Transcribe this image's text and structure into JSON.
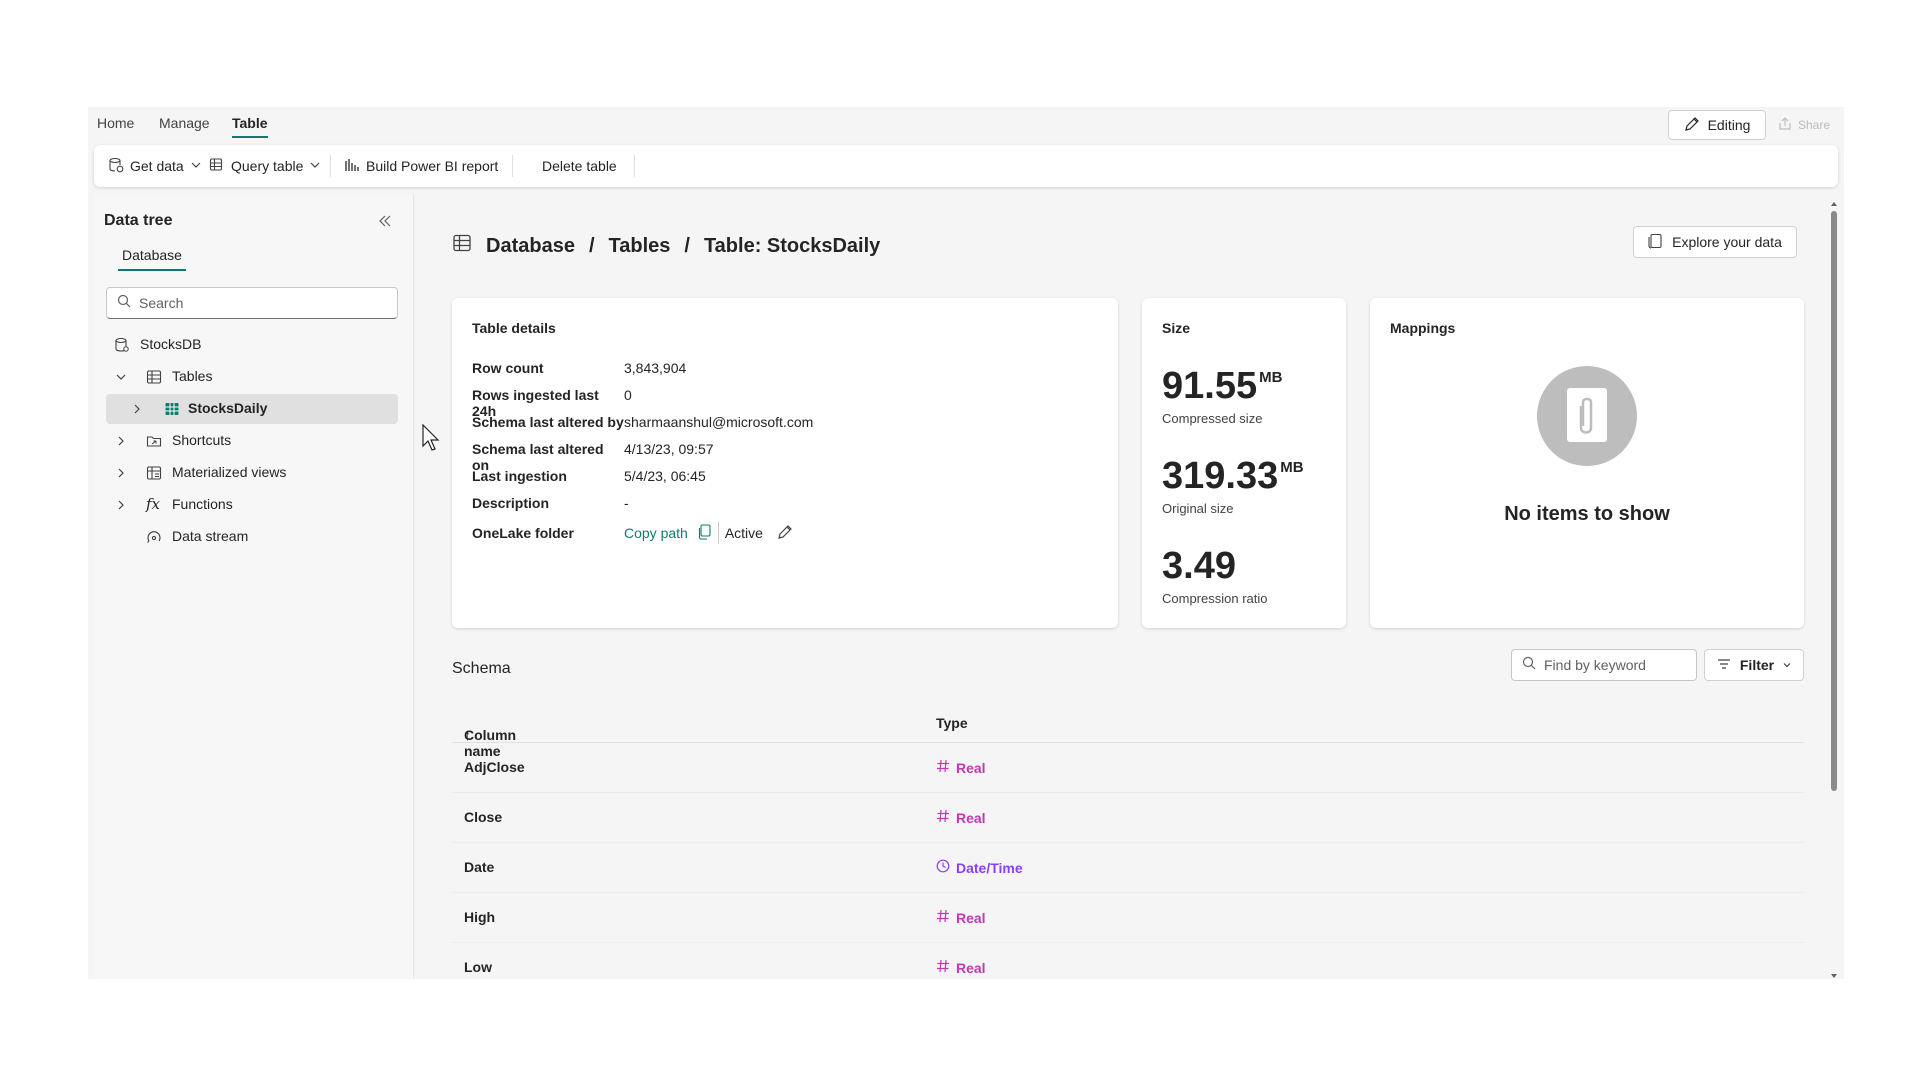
{
  "topnav": {
    "tabs": [
      {
        "label": "Home"
      },
      {
        "label": "Manage"
      },
      {
        "label": "Table"
      }
    ],
    "active_tab": "Table",
    "editing_label": "Editing",
    "share_label": "Share"
  },
  "ribbon": {
    "get_data": "Get data",
    "query_table": "Query table",
    "build_report": "Build Power BI report",
    "delete_table": "Delete table"
  },
  "sidebar": {
    "title": "Data tree",
    "tab": "Database",
    "search_placeholder": "Search",
    "items": [
      {
        "label": "StocksDB",
        "icon": "database-icon"
      },
      {
        "label": "Tables",
        "icon": "table-icon",
        "expanded": true
      },
      {
        "label": "StocksDaily",
        "icon": "table-icon",
        "selected": true
      },
      {
        "label": "Shortcuts",
        "icon": "shortcut-icon"
      },
      {
        "label": "Materialized views",
        "icon": "materialized-view-icon"
      },
      {
        "label": "Functions",
        "icon": "function-icon"
      },
      {
        "label": "Data stream",
        "icon": "data-stream-icon"
      }
    ]
  },
  "breadcrumb": {
    "items": [
      "Database",
      "Tables",
      "Table: StocksDaily"
    ],
    "separator": "/"
  },
  "explore_label": "Explore your data",
  "table_details": {
    "title": "Table details",
    "rows": [
      {
        "key": "Row count",
        "value": "3,843,904"
      },
      {
        "key": "Rows ingested last 24h",
        "value": "0"
      },
      {
        "key": "Schema last altered by",
        "value": "sharmaanshul@microsoft.com"
      },
      {
        "key": "Schema last altered on",
        "value": "4/13/23, 09:57"
      },
      {
        "key": "Last ingestion",
        "value": "5/4/23, 06:45"
      },
      {
        "key": "Description",
        "value": "-"
      }
    ],
    "onelake_key": "OneLake folder",
    "copy_path": "Copy path",
    "status": "Active"
  },
  "size": {
    "title": "Size",
    "compressed_value": "91.55",
    "compressed_unit": "MB",
    "compressed_label": "Compressed size",
    "original_value": "319.33",
    "original_unit": "MB",
    "original_label": "Original size",
    "ratio_value": "3.49",
    "ratio_label": "Compression ratio"
  },
  "mappings": {
    "title": "Mappings",
    "empty_text": "No items to show"
  },
  "schema": {
    "title": "Schema",
    "find_placeholder": "Find by keyword",
    "filter_label": "Filter",
    "columns": [
      "Column name",
      "Type"
    ],
    "sort_indicator": "↑",
    "rows": [
      {
        "name": "AdjClose",
        "type": "Real",
        "icon": "hash-icon"
      },
      {
        "name": "Close",
        "type": "Real",
        "icon": "hash-icon"
      },
      {
        "name": "Date",
        "type": "Date/Time",
        "icon": "clock-icon"
      },
      {
        "name": "High",
        "type": "Real",
        "icon": "hash-icon"
      },
      {
        "name": "Low",
        "type": "Real",
        "icon": "hash-icon"
      }
    ]
  },
  "colors": {
    "accent": "#0f7b6c",
    "real_type": "#c239b3",
    "datetime_type": "#8a3ffc"
  }
}
